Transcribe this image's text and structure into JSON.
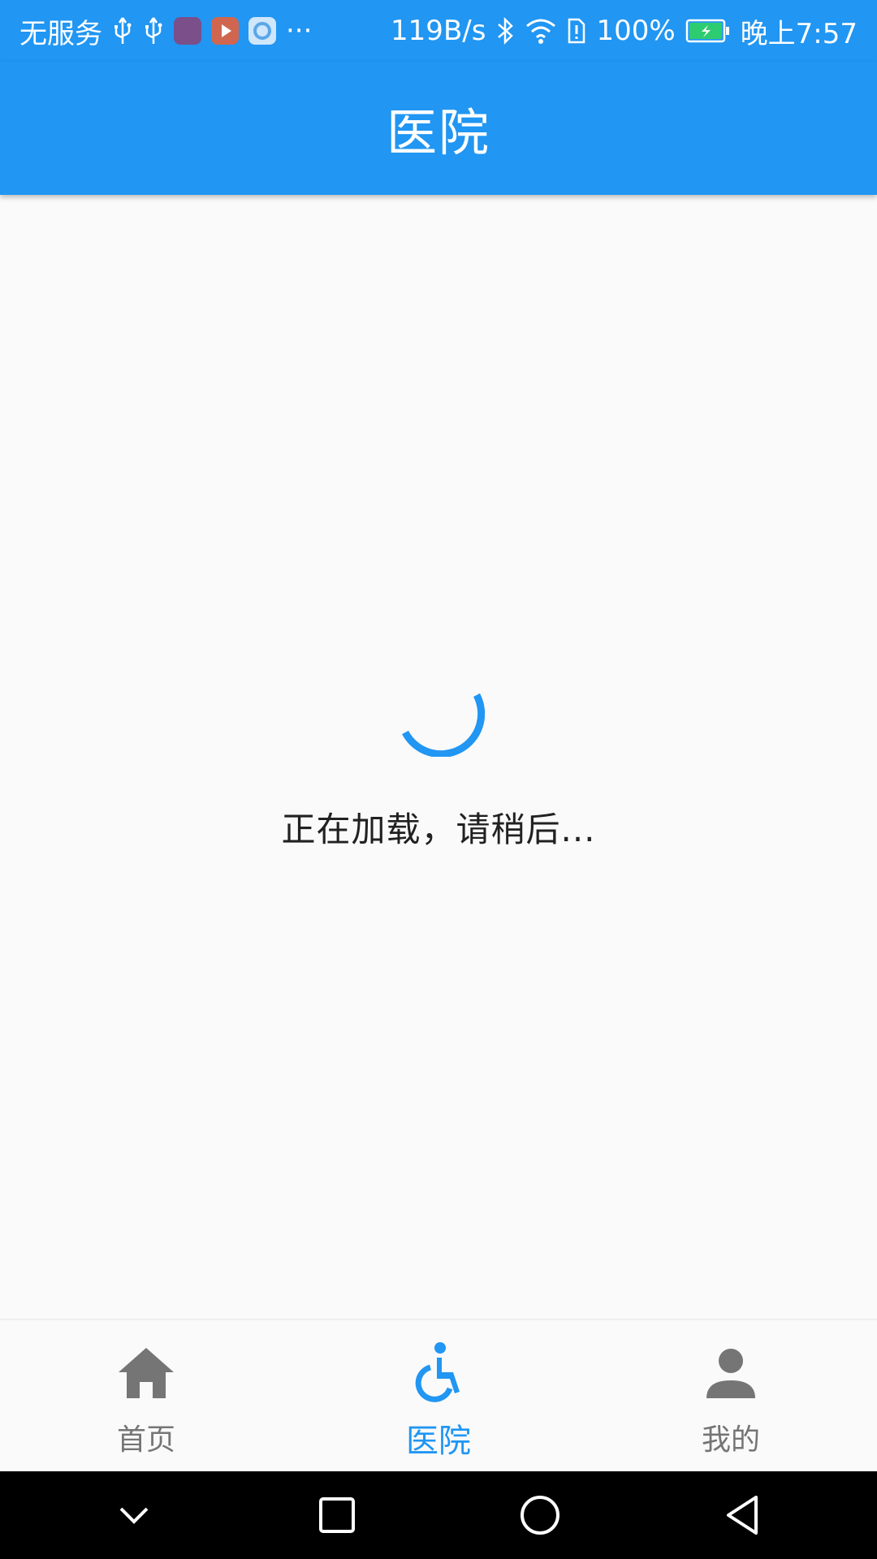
{
  "status_bar": {
    "carrier": "无服务",
    "net_speed": "119B/s",
    "battery_percent": "100%",
    "time": "晚上7:57",
    "more_label": "···",
    "icons": [
      "usb-icon",
      "usb-icon",
      "app-icon",
      "video-app-icon",
      "cloud-app-icon",
      "bluetooth-icon",
      "wifi-icon",
      "sim-alert-icon",
      "battery-charging-icon"
    ]
  },
  "app_bar": {
    "title": "医院"
  },
  "loading": {
    "text": "正在加载，请稍后..."
  },
  "bottom_nav": {
    "items": [
      {
        "label": "首页",
        "icon": "home-icon",
        "active": false
      },
      {
        "label": "医院",
        "icon": "accessible-icon",
        "active": true
      },
      {
        "label": "我的",
        "icon": "person-icon",
        "active": false
      }
    ],
    "active_color": "#2196f3",
    "inactive_color": "#757575"
  },
  "system_nav": {
    "buttons": [
      "collapse-icon",
      "recents-icon",
      "home-circle-icon",
      "back-icon"
    ]
  },
  "colors": {
    "primary": "#2196f3",
    "background": "#fafafa"
  }
}
